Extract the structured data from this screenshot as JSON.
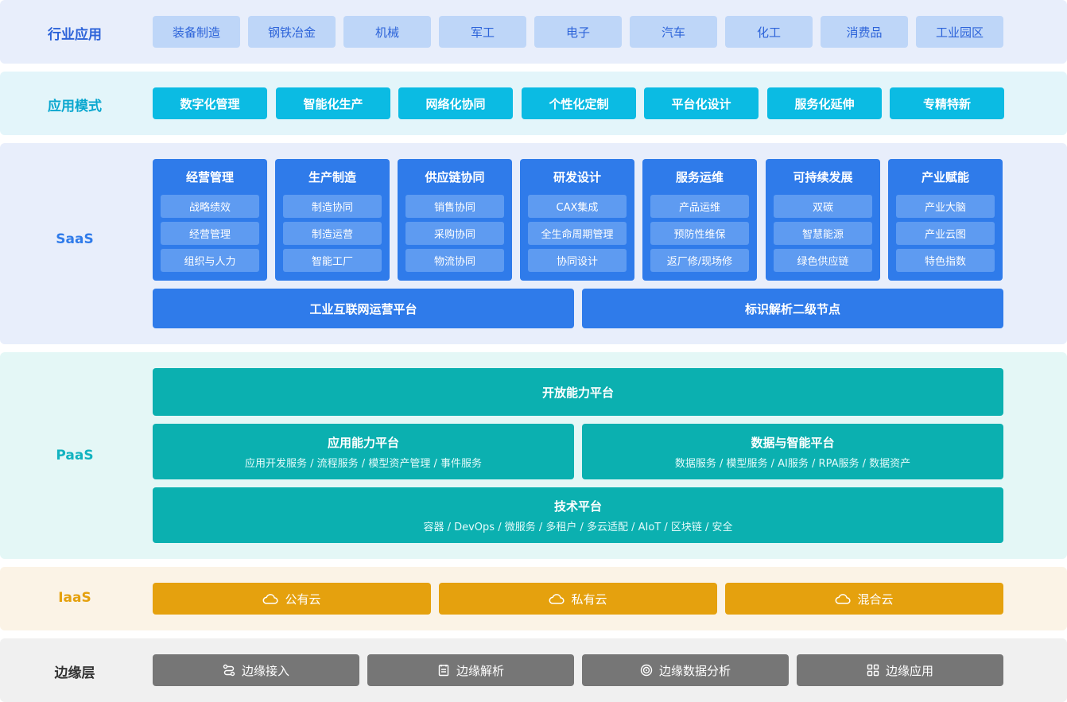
{
  "industry": {
    "label": "行业应用",
    "items": [
      "装备制造",
      "钢铁冶金",
      "机械",
      "军工",
      "电子",
      "汽车",
      "化工",
      "消费品",
      "工业园区"
    ]
  },
  "mode": {
    "label": "应用模式",
    "items": [
      "数字化管理",
      "智能化生产",
      "网络化协同",
      "个性化定制",
      "平台化设计",
      "服务化延伸",
      "专精特新"
    ]
  },
  "saas": {
    "label": "SaaS",
    "columns": [
      {
        "title": "经营管理",
        "items": [
          "战略绩效",
          "经营管理",
          "组织与人力"
        ]
      },
      {
        "title": "生产制造",
        "items": [
          "制造协同",
          "制造运营",
          "智能工厂"
        ]
      },
      {
        "title": "供应链协同",
        "items": [
          "销售协同",
          "采购协同",
          "物流协同"
        ]
      },
      {
        "title": "研发设计",
        "items": [
          "CAX集成",
          "全生命周期管理",
          "协同设计"
        ]
      },
      {
        "title": "服务运维",
        "items": [
          "产品运维",
          "预防性维保",
          "返厂修/现场修"
        ]
      },
      {
        "title": "可持续发展",
        "items": [
          "双碳",
          "智慧能源",
          "绿色供应链"
        ]
      },
      {
        "title": "产业赋能",
        "items": [
          "产业大脑",
          "产业云图",
          "特色指数"
        ]
      }
    ],
    "platforms": [
      "工业互联网运营平台",
      "标识解析二级节点"
    ]
  },
  "paas": {
    "label": "PaaS",
    "open_platform": "开放能力平台",
    "app_platform": {
      "title": "应用能力平台",
      "desc": "应用开发服务 / 流程服务 / 模型资产管理 / 事件服务"
    },
    "data_platform": {
      "title": "数据与智能平台",
      "desc": "数据服务 / 模型服务 / AI服务 / RPA服务 / 数据资产"
    },
    "tech_platform": {
      "title": "技术平台",
      "desc": "容器 / DevOps / 微服务 / 多租户 / 多云适配 / AIoT / 区块链 / 安全"
    }
  },
  "iaas": {
    "label": "IaaS",
    "items": [
      {
        "icon": "cloud-icon",
        "label": "公有云"
      },
      {
        "icon": "cloud-icon",
        "label": "私有云"
      },
      {
        "icon": "cloud-icon",
        "label": "混合云"
      }
    ]
  },
  "edge": {
    "label": "边缘层",
    "items": [
      {
        "icon": "connect-icon",
        "label": "边缘接入"
      },
      {
        "icon": "document-parse-icon",
        "label": "边缘解析"
      },
      {
        "icon": "radar-icon",
        "label": "边缘数据分析"
      },
      {
        "icon": "grid-apps-icon",
        "label": "边缘应用"
      }
    ]
  },
  "colors": {
    "industry_bg": "#e8eefb",
    "industry_chip": "#bed6f8",
    "industry_text": "#2c63d9",
    "mode_bg": "#e3f5fa",
    "mode_chip": "#0bbbe3",
    "mode_label": "#0aa7cf",
    "saas_bg": "#e8eefb",
    "saas_blue": "#2f7bea",
    "saas_sub": "#5e9bf1",
    "paas_bg": "#e4f7f6",
    "paas_teal": "#0bb0b0",
    "paas_label": "#12b3c0",
    "iaas_bg": "#fbf3e6",
    "iaas_orange": "#e5a10e",
    "edge_bg": "#f0f0f0",
    "edge_gray": "#767676",
    "edge_label": "#333333"
  }
}
